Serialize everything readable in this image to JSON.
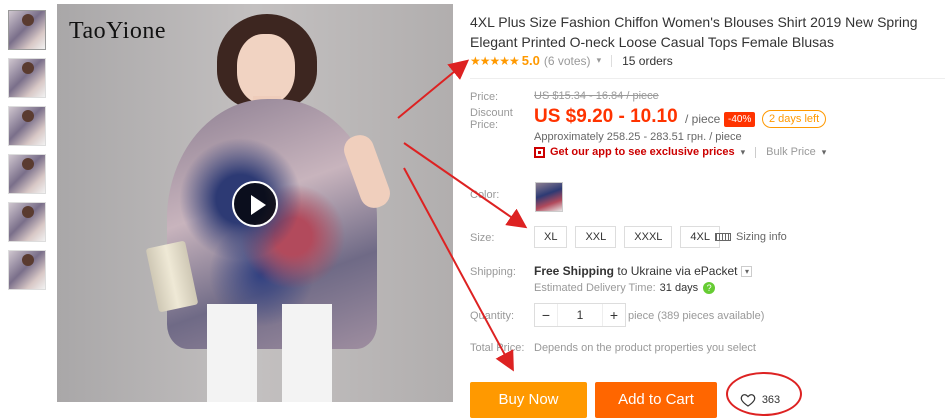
{
  "gallery": {
    "brand": "TaoYione",
    "thumbnail_count": 6
  },
  "product": {
    "title": "4XL Plus Size Fashion Chiffon Women's Blouses Shirt 2019 New Spring Elegant Printed O-neck Loose Casual Tops Female Blusas",
    "stars": "★★★★★",
    "rating": "5.0",
    "votes": "(6 votes)",
    "orders": "15 orders"
  },
  "price": {
    "price_label": "Price:",
    "old_price": "US $15.34 - 16.84 / piece",
    "discount_label": "Discount Price:",
    "new_price": "US $9.20 - 10.10",
    "per_piece": "/ piece",
    "discount_badge": "-40%",
    "days_left": "2 days left",
    "approx": "Approximately 258.25 - 283.51 грн. / piece",
    "app_link": "Get our app to see exclusive prices",
    "bulk_price": "Bulk Price"
  },
  "options": {
    "color_label": "Color:",
    "size_label": "Size:",
    "sizes": [
      "XL",
      "XXL",
      "XXXL",
      "4XL"
    ],
    "sizing_info": "Sizing info"
  },
  "shipping": {
    "label": "Shipping:",
    "free_shipping": "Free Shipping",
    "to": "to",
    "destination": "Ukraine",
    "via": "via ePacket",
    "estimated_label": "Estimated Delivery Time:",
    "estimated_value": "31 days"
  },
  "quantity": {
    "label": "Quantity:",
    "minus": "−",
    "value": "1",
    "plus": "+",
    "note": "piece (389 pieces available)"
  },
  "total": {
    "label": "Total Price:",
    "note": "Depends on the product properties you select"
  },
  "actions": {
    "buy_now": "Buy Now",
    "add_to_cart": "Add to Cart",
    "wishlist_count": "363"
  },
  "colors": {
    "accent_orange": "#ff9900",
    "cart_orange": "#ff6600",
    "price_red": "#ff3300",
    "annotation_red": "#dd2222"
  }
}
